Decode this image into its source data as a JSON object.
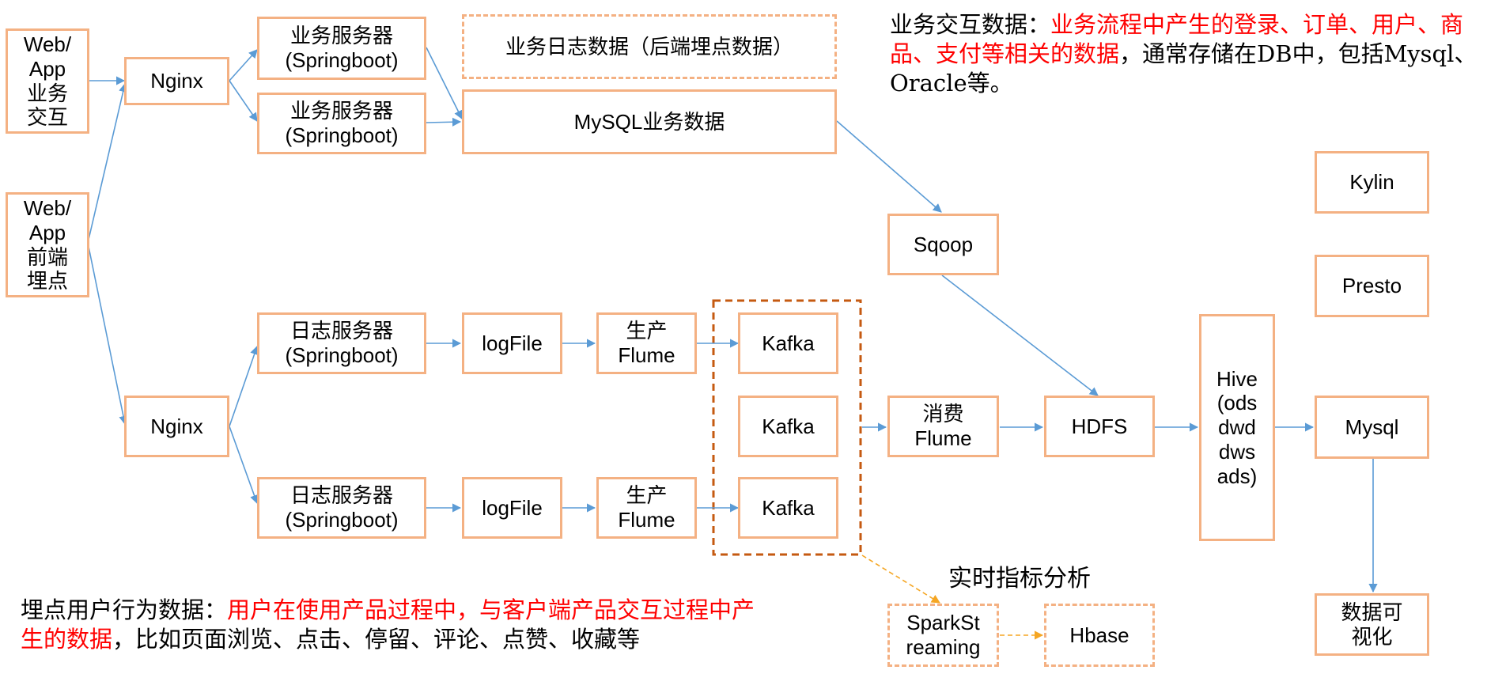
{
  "nodes": {
    "web_app_business": "Web/\nApp\n业务\n交互",
    "web_app_frontend": "Web/\nApp\n前端\n埋点",
    "nginx_top": "Nginx",
    "nginx_bottom": "Nginx",
    "biz_server_1": "业务服务器\n(Springboot)",
    "biz_server_2": "业务服务器\n(Springboot)",
    "biz_log_data": "业务日志数据（后端埋点数据）",
    "mysql_biz_data": "MySQL业务数据",
    "log_server_1": "日志服务器\n(Springboot)",
    "log_server_2": "日志服务器\n(Springboot)",
    "logfile_1": "logFile",
    "logfile_2": "logFile",
    "producer_flume_1": "生产\nFlume",
    "producer_flume_2": "生产\nFlume",
    "kafka_1": "Kafka",
    "kafka_2": "Kafka",
    "kafka_3": "Kafka",
    "sqoop": "Sqoop",
    "consumer_flume": "消费\nFlume",
    "hdfs": "HDFS",
    "hive": "Hive\n(ods\ndwd\ndws\nads)",
    "kylin": "Kylin",
    "presto": "Presto",
    "mysql": "Mysql",
    "data_visualization": "数据可\n视化",
    "spark_streaming": "SparkSt\nreaming",
    "hbase": "Hbase"
  },
  "headings": {
    "realtime_metrics": "实时指标分析"
  },
  "annotations": {
    "business_data": {
      "label": "业务交互数据：",
      "highlight": "业务流程中产生的登录、订单、用户、商品、支付等相关的数据",
      "rest": "，通常存储在DB中，包括Mysql、Oracle等。"
    },
    "tracking_data": {
      "label": "埋点用户行为数据：",
      "highlight": "用户在使用产品过程中，与客户端产品交互过程中产生的数据",
      "rest": "，比如页面浏览、点击、停留、评论、点赞、收藏等"
    }
  },
  "colors": {
    "box_border": "#F4B183",
    "arrow": "#5B9BD5",
    "kafka_group_border": "#C55A11",
    "realtime_arrow": "#F5A623",
    "highlight_text": "#FF0000"
  }
}
